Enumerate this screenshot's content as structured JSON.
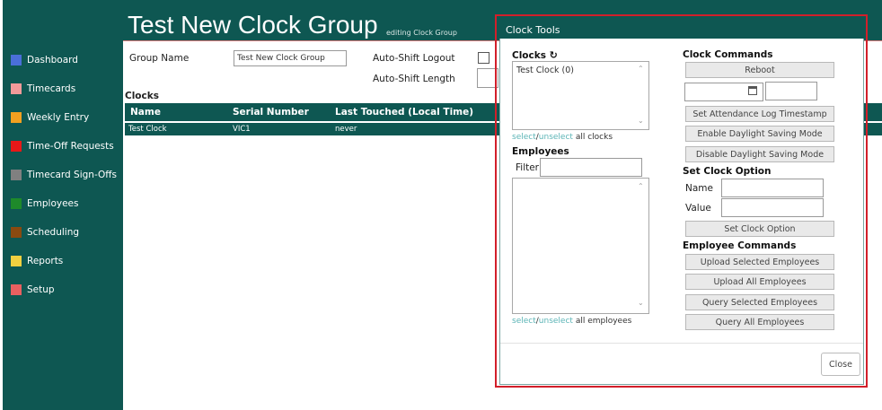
{
  "header": {
    "title": "Test New Clock Group",
    "subtitle": "editing Clock Group"
  },
  "sidebar": {
    "items": [
      {
        "label": "Dashboard",
        "color": "#4a6fd8"
      },
      {
        "label": "Timecards",
        "color": "#f29a9a"
      },
      {
        "label": "Weekly Entry",
        "color": "#f2a020"
      },
      {
        "label": "Time-Off Requests",
        "color": "#e81818"
      },
      {
        "label": "Timecard Sign-Offs",
        "color": "#808080"
      },
      {
        "label": "Employees",
        "color": "#1e8a2a"
      },
      {
        "label": "Scheduling",
        "color": "#8a4a10"
      },
      {
        "label": "Reports",
        "color": "#f2d040"
      },
      {
        "label": "Setup",
        "color": "#e86060"
      }
    ]
  },
  "form": {
    "group_name_label": "Group Name",
    "group_name_value": "Test New Clock Group",
    "auto_shift_logout_label": "Auto-Shift Logout",
    "auto_shift_length_label": "Auto-Shift Length",
    "clocks_label": "Clocks"
  },
  "table": {
    "columns": [
      "Name",
      "Serial Number",
      "Last Touched (Local Time)"
    ],
    "rows": [
      {
        "name": "Test Clock",
        "serial": "VIC1",
        "last_touched": "never"
      }
    ]
  },
  "modal": {
    "title": "Clock Tools",
    "clocks_label": "Clocks",
    "clock_items": [
      "Test Clock (0)"
    ],
    "select_link": "select",
    "slash": "/",
    "unselect_link": "unselect",
    "all_clocks": "all clocks",
    "employees_label": "Employees",
    "filter_label": "Filter",
    "all_employees": "all employees",
    "clock_commands_label": "Clock Commands",
    "reboot_button": "Reboot",
    "set_attendance_button": "Set Attendance Log Timestamp",
    "enable_dst_button": "Enable Daylight Saving Mode",
    "disable_dst_button": "Disable Daylight Saving Mode",
    "set_clock_option_label": "Set Clock Option",
    "name_label": "Name",
    "value_label": "Value",
    "set_clock_option_button": "Set Clock Option",
    "employee_commands_label": "Employee Commands",
    "upload_selected_button": "Upload Selected Employees",
    "upload_all_button": "Upload All Employees",
    "query_selected_button": "Query Selected Employees",
    "query_all_button": "Query All Employees",
    "close_button": "Close"
  },
  "colors": {
    "theme": "#0e5752",
    "highlight_outline": "#d21f2a",
    "link": "#5bb4b6"
  }
}
